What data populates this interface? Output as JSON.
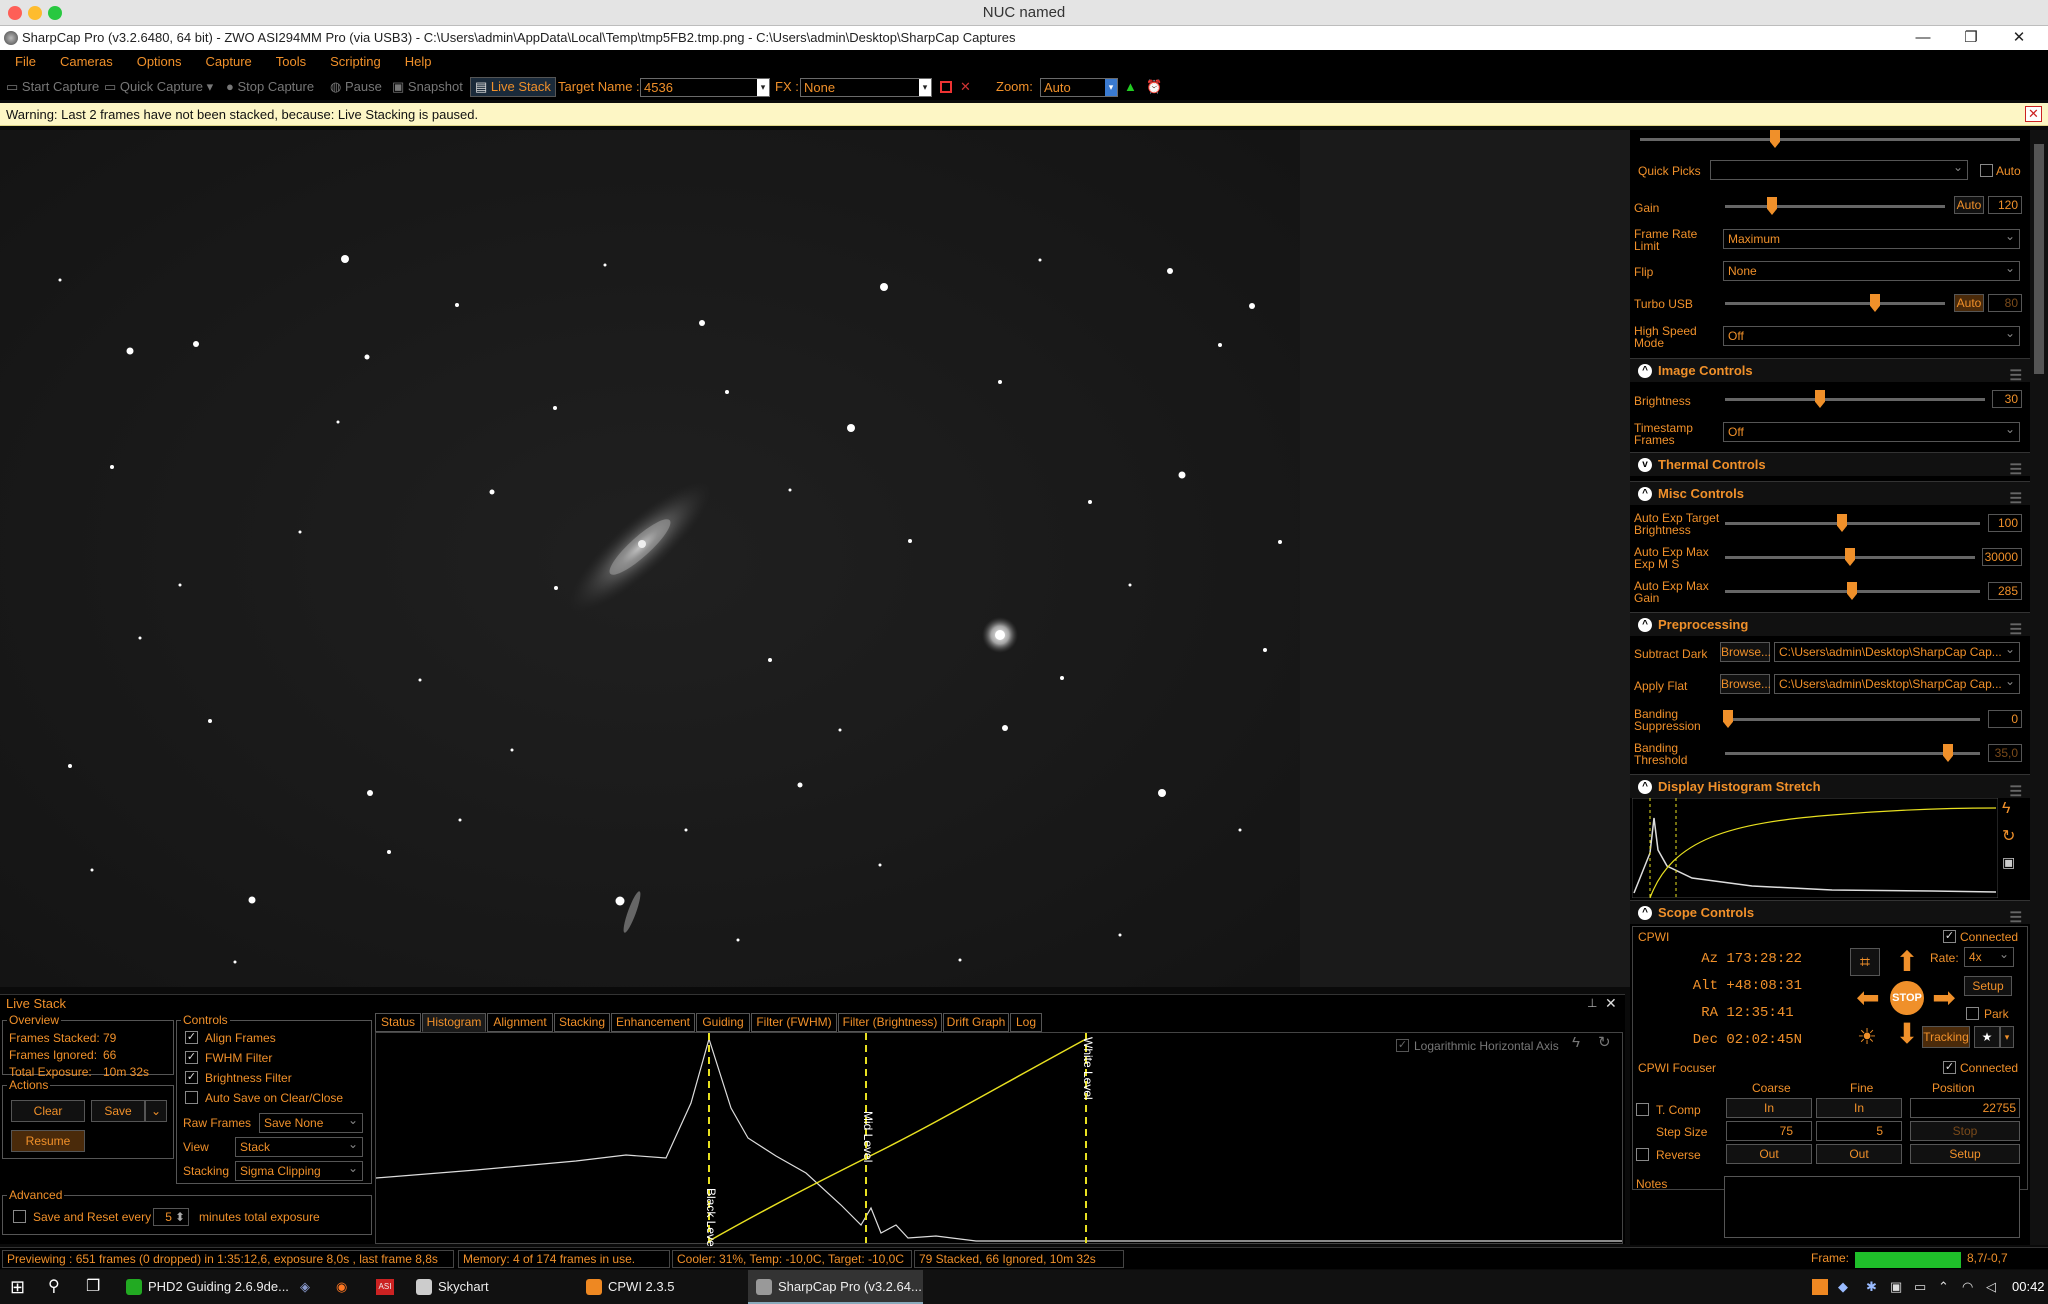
{
  "mac": {
    "title": "NUC named"
  },
  "window": {
    "title": "SharpCap Pro (v3.2.6480, 64 bit) - ZWO ASI294MM Pro (via USB3) - C:\\Users\\admin\\AppData\\Local\\Temp\\tmp5FB2.tmp.png - C:\\Users\\admin\\Desktop\\SharpCap Captures",
    "minimize": "—",
    "restore": "❐",
    "close": "✕"
  },
  "menu": [
    "File",
    "Cameras",
    "Options",
    "Capture",
    "Tools",
    "Scripting",
    "Help"
  ],
  "toolbar": {
    "start_capture": "Start Capture",
    "quick_capture": "Quick Capture",
    "stop_capture": "Stop Capture",
    "pause": "Pause",
    "snapshot": "Snapshot",
    "live_stack": "Live Stack",
    "target_name_label": "Target Name :",
    "target_name_value": "4536",
    "fx_label": "FX :",
    "fx_value": "None",
    "zoom_label": "Zoom:",
    "zoom_value": "Auto"
  },
  "warning": {
    "text": "Warning: Last 2 frames have not been stacked, because: Live Stacking is paused."
  },
  "camera_panel": {
    "quick_picks_label": "Quick Picks",
    "auto_label": "Auto",
    "gain_label": "Gain",
    "gain_auto": "Auto",
    "gain_value": "120",
    "frame_rate_label": "Frame Rate Limit",
    "frame_rate_value": "Maximum",
    "flip_label": "Flip",
    "flip_value": "None",
    "turbo_usb_label": "Turbo USB",
    "turbo_auto": "Auto",
    "turbo_value": "80",
    "high_speed_label": "High Speed Mode",
    "high_speed_value": "Off"
  },
  "image_controls": {
    "title": "Image Controls",
    "brightness_label": "Brightness",
    "brightness_value": "30",
    "timestamp_label": "Timestamp Frames",
    "timestamp_value": "Off"
  },
  "thermal_controls": {
    "title": "Thermal Controls"
  },
  "misc_controls": {
    "title": "Misc Controls",
    "target_brightness_label": "Auto Exp Target Brightness",
    "target_brightness_value": "100",
    "max_exp_label": "Auto Exp Max Exp M S",
    "max_exp_value": "30000",
    "max_gain_label": "Auto Exp Max Gain",
    "max_gain_value": "285"
  },
  "preprocessing": {
    "title": "Preprocessing",
    "subtract_dark_label": "Subtract Dark",
    "browse": "Browse...",
    "dark_path": "C:\\Users\\admin\\Desktop\\SharpCap Cap...",
    "apply_flat_label": "Apply Flat",
    "flat_path": "C:\\Users\\admin\\Desktop\\SharpCap Cap...",
    "banding_suppression_label": "Banding Suppression",
    "banding_suppression_value": "0",
    "banding_threshold_label": "Banding Threshold",
    "banding_threshold_value": "35,0"
  },
  "display_histogram": {
    "title": "Display Histogram Stretch"
  },
  "scope_controls": {
    "title": "Scope Controls",
    "mount": "CPWI",
    "connected": "Connected",
    "az_label": "Az",
    "az_value": "173:28:22",
    "alt_label": "Alt",
    "alt_value": "+48:08:31",
    "ra_label": "RA",
    "ra_value": "12:35:41",
    "dec_label": "Dec",
    "dec_value": "02:02:45N",
    "rate_label": "Rate:",
    "rate_value": "4x",
    "setup": "Setup",
    "park": "Park",
    "stop": "STOP",
    "tracking": "Tracking"
  },
  "focuser": {
    "title": "CPWI Focuser",
    "connected": "Connected",
    "coarse": "Coarse",
    "fine": "Fine",
    "position": "Position",
    "tcomp": "T. Comp",
    "in": "In",
    "position_value": "22755",
    "step_size": "Step Size",
    "coarse_step": "75",
    "fine_step": "5",
    "stop": "Stop",
    "reverse": "Reverse",
    "out": "Out",
    "setup": "Setup",
    "notes": "Notes"
  },
  "live_stack": {
    "title": "Live Stack",
    "overview_title": "Overview",
    "frames_stacked_label": "Frames Stacked:",
    "frames_stacked_value": "79",
    "frames_ignored_label": "Frames Ignored:",
    "frames_ignored_value": "66",
    "total_exposure_label": "Total Exposure:",
    "total_exposure_value": "10m 32s",
    "actions_title": "Actions",
    "clear": "Clear",
    "save": "Save",
    "resume": "Resume",
    "advanced_title": "Advanced",
    "save_reset_label": "Save and Reset every",
    "save_reset_value": "5",
    "minutes_label": "minutes total exposure",
    "controls_title": "Controls",
    "align_frames": "Align Frames",
    "fwhm_filter": "FWHM Filter",
    "brightness_filter": "Brightness Filter",
    "auto_save": "Auto Save on Clear/Close",
    "raw_frames_label": "Raw Frames",
    "raw_frames_value": "Save None",
    "view_label": "View",
    "view_value": "Stack",
    "stacking_label": "Stacking",
    "stacking_value": "Sigma Clipping",
    "tabs": [
      "Status",
      "Histogram",
      "Alignment",
      "Stacking",
      "Enhancement",
      "Guiding",
      "Filter (FWHM)",
      "Filter (Brightness)",
      "Drift Graph",
      "Log"
    ],
    "log_axis_label": "Logarithmic Horizontal Axis",
    "black_level": "Black Level",
    "mid_level": "Mid Level",
    "white_level": "White Level"
  },
  "status": {
    "preview": "Previewing : 651 frames (0 dropped) in 1:35:12,6, exposure 8,0s , last frame 8,8s",
    "memory": "Memory: 4 of 174 frames in use.",
    "cooler": "Cooler: 31%, Temp: -10,0C, Target: -10,0C",
    "stacked": "79 Stacked, 66 Ignored, 10m 32s",
    "frame_label": "Frame:",
    "frame_value": "8,7/-0,7"
  },
  "taskbar": {
    "apps": [
      "PHD2 Guiding 2.6.9de...",
      "Skychart",
      "CPWI 2.3.5",
      "SharpCap Pro (v3.2.64..."
    ],
    "clock": "00:42"
  },
  "colors": {
    "accent": "#f0902a",
    "warning_bg": "#fdf6c5",
    "frame_green": "#1fbf2a",
    "guide_yellow": "#e8e020"
  }
}
